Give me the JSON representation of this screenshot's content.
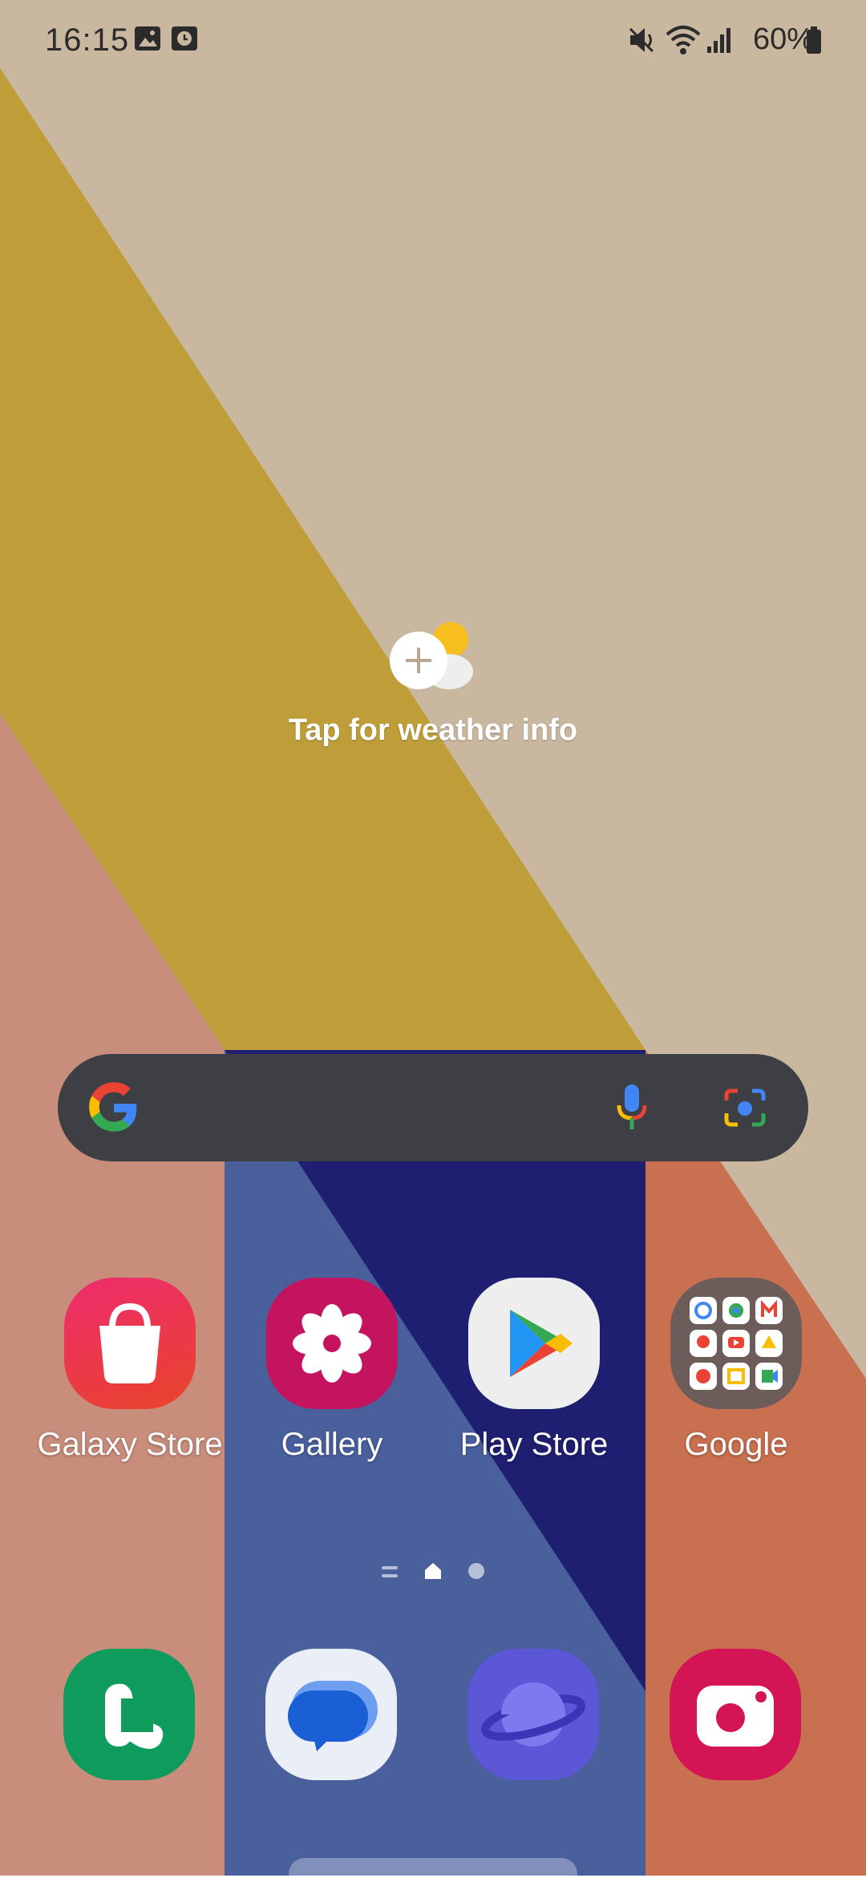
{
  "status_bar": {
    "time": "16:15",
    "battery_percent": "60%",
    "icons": [
      "gallery-notification-icon",
      "clock-notification-icon",
      "mute-icon",
      "wifi-icon",
      "signal-icon",
      "battery-icon"
    ]
  },
  "weather_widget": {
    "label": "Tap for weather info",
    "icon": "weather-add-icon"
  },
  "search_bar": {
    "icons": [
      "google-logo-icon",
      "microphone-icon",
      "google-lens-icon"
    ]
  },
  "apps": [
    {
      "label": "Galaxy Store",
      "icon": "galaxy-store-icon",
      "color": "#e8305a"
    },
    {
      "label": "Gallery",
      "icon": "gallery-icon",
      "color": "#c4135f"
    },
    {
      "label": "Play Store",
      "icon": "play-store-icon",
      "color": "#eeeeee"
    },
    {
      "label": "Google",
      "icon": "google-folder-icon",
      "color": "#6d5d5a"
    }
  ],
  "page_indicator": {
    "pages": 3,
    "current": 2
  },
  "dock": [
    {
      "icon": "phone-icon",
      "color": "#0e9b5c"
    },
    {
      "icon": "messages-icon",
      "color": "#e9eef7"
    },
    {
      "icon": "samsung-internet-icon",
      "color": "#5b57d6"
    },
    {
      "icon": "camera-icon",
      "color": "#d31455"
    }
  ],
  "colors": {
    "wall_beige": "#c9b79f",
    "wall_gold": "#bf9e3a",
    "wall_salmon": "#c98d7c",
    "wall_blue": "#49609d",
    "wall_navy": "#1f1f72",
    "wall_orange": "#c8704f",
    "search_bg": "#3d3f45"
  }
}
